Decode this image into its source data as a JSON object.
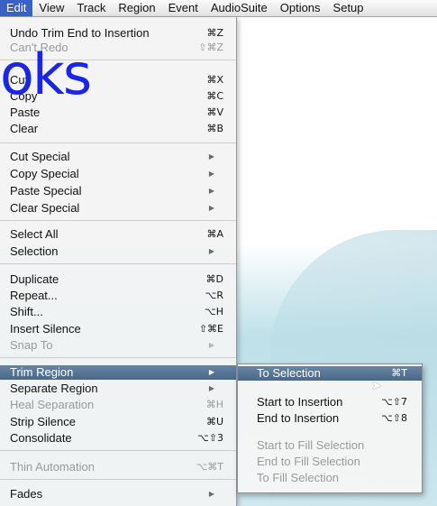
{
  "menubar": [
    "Edit",
    "View",
    "Track",
    "Region",
    "Event",
    "AudioSuite",
    "Options",
    "Setup"
  ],
  "watermark": "oks",
  "edit_menu": [
    {
      "label": "Undo Trim End to Insertion",
      "shortcut": "⌘Z"
    },
    {
      "label": "Can't Redo",
      "shortcut": "⇧⌘Z",
      "disabled": true
    },
    {
      "label": "Cut",
      "shortcut": "⌘X"
    },
    {
      "label": "Copy",
      "shortcut": "⌘C"
    },
    {
      "label": "Paste",
      "shortcut": "⌘V"
    },
    {
      "label": "Clear",
      "shortcut": "⌘B"
    },
    {
      "label": "Cut Special",
      "submenu": true
    },
    {
      "label": "Copy Special",
      "submenu": true
    },
    {
      "label": "Paste Special",
      "submenu": true
    },
    {
      "label": "Clear Special",
      "submenu": true
    },
    {
      "label": "Select All",
      "shortcut": "⌘A"
    },
    {
      "label": "Selection",
      "submenu": true
    },
    {
      "label": "Duplicate",
      "shortcut": "⌘D"
    },
    {
      "label": "Repeat...",
      "shortcut": "⌥R"
    },
    {
      "label": "Shift...",
      "shortcut": "⌥H"
    },
    {
      "label": "Insert Silence",
      "shortcut": "⇧⌘E"
    },
    {
      "label": "Snap To",
      "submenu": true,
      "disabled": true
    },
    {
      "label": "Trim Region",
      "submenu": true,
      "selected": true
    },
    {
      "label": "Separate Region",
      "submenu": true
    },
    {
      "label": "Heal Separation",
      "shortcut": "⌘H",
      "disabled": true
    },
    {
      "label": "Strip Silence",
      "shortcut": "⌘U"
    },
    {
      "label": "Consolidate",
      "shortcut": "⌥⇧3"
    },
    {
      "label": "Thin Automation",
      "shortcut": "⌥⌘T",
      "disabled": true
    },
    {
      "label": "Fades",
      "submenu": true
    }
  ],
  "trim_submenu": [
    {
      "label": "To Selection",
      "shortcut": "⌘T",
      "selected": true
    },
    {
      "label": "Start to Insertion",
      "shortcut": "⌥⇧7"
    },
    {
      "label": "End to Insertion",
      "shortcut": "⌥⇧8"
    },
    {
      "label": "Start to Fill Selection",
      "disabled": true
    },
    {
      "label": "End to Fill Selection",
      "disabled": true
    },
    {
      "label": "To Fill Selection",
      "disabled": true
    }
  ]
}
